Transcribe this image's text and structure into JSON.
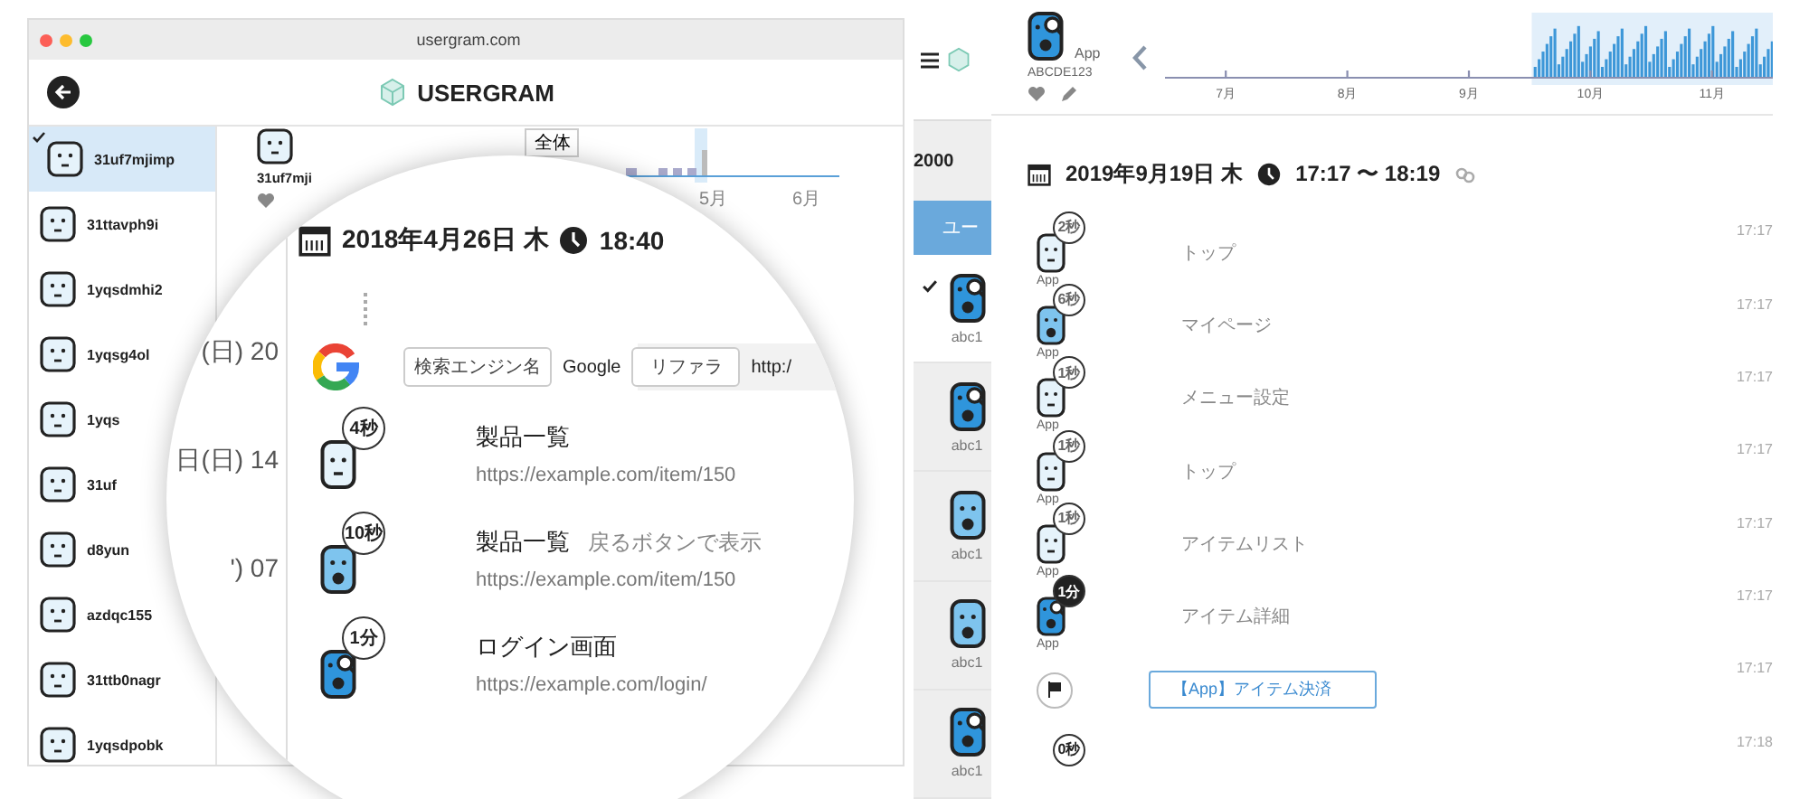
{
  "left_window": {
    "title": "usergram.com",
    "logo": "USERGRAM",
    "users": [
      {
        "name": "31uf7mjimp",
        "selected": true
      },
      {
        "name": "31ttavph9i",
        "selected": false
      },
      {
        "name": "1yqsdmhi2",
        "selected": false
      },
      {
        "name": "1yqsg4ol",
        "selected": false
      },
      {
        "name": "1yqs",
        "selected": false
      },
      {
        "name": "31uf",
        "selected": false
      },
      {
        "name": "d8yun",
        "selected": false
      },
      {
        "name": "azdqc155",
        "selected": false
      },
      {
        "name": "31ttb0nagr",
        "selected": false
      },
      {
        "name": "1yqsdpobk",
        "selected": false
      }
    ],
    "user_header": {
      "name": "31uf7mji",
      "scope_button": "全体",
      "months": [
        "5月",
        "6月"
      ]
    }
  },
  "magnifier": {
    "list_fragments": [
      "(日) 20",
      "日(日) 14",
      "') 07"
    ],
    "date": "2018年4月26日 木",
    "time": "18:40",
    "referrer": {
      "engine_label": "検索エンジン名",
      "engine": "Google",
      "referrer_label": "リファラ",
      "referrer": "http:/"
    },
    "visits": [
      {
        "duration": "4秒",
        "kind": "plain",
        "title": "製品一覧",
        "url": "https://example.com/item/150"
      },
      {
        "duration": "10秒",
        "kind": "open",
        "title": "製品一覧",
        "note": "戻るボタンで表示",
        "url": "https://example.com/item/150"
      },
      {
        "duration": "1分",
        "kind": "search",
        "title": "ログイン画面",
        "url": "https://example.com/login/"
      }
    ]
  },
  "right_panel": {
    "strip": {
      "count": "2000",
      "tab": "ユー",
      "users": [
        {
          "id": "abc1",
          "kind": "search",
          "selected": true
        },
        {
          "id": "abc1",
          "kind": "search",
          "selected": false
        },
        {
          "id": "abc1",
          "kind": "open",
          "selected": false
        },
        {
          "id": "abc1",
          "kind": "open",
          "selected": false
        },
        {
          "id": "abc1",
          "kind": "search",
          "selected": false
        }
      ]
    },
    "app": {
      "platform": "App",
      "id": "ABCDE123",
      "months": [
        "7月",
        "8月",
        "9月",
        "10月",
        "11月"
      ]
    },
    "date": "2019年9月19日 木",
    "time": "17:17 〜 18:19",
    "events": [
      {
        "kind": "plain",
        "duration": "2秒",
        "highlighted": false,
        "platform": "App",
        "title": "トップ",
        "time": "17:17"
      },
      {
        "kind": "open",
        "duration": "6秒",
        "highlighted": false,
        "platform": "App",
        "title": "マイページ",
        "time": "17:17"
      },
      {
        "kind": "plain",
        "duration": "1秒",
        "highlighted": false,
        "platform": "App",
        "title": "メニュー設定",
        "time": "17:17"
      },
      {
        "kind": "plain",
        "duration": "1秒",
        "highlighted": false,
        "platform": "App",
        "title": "トップ",
        "time": "17:17"
      },
      {
        "kind": "plain",
        "duration": "1秒",
        "highlighted": false,
        "platform": "App",
        "title": "アイテムリスト",
        "time": "17:17"
      },
      {
        "kind": "search",
        "duration": "1分",
        "highlighted": true,
        "platform": "App",
        "title": "アイテム詳細",
        "time": "17:17"
      },
      {
        "kind": "goal",
        "title": "【App】アイテム決済",
        "time": "17:17"
      },
      {
        "kind": "partial",
        "duration": "0秒",
        "highlighted": false,
        "time": "17:18"
      }
    ]
  }
}
